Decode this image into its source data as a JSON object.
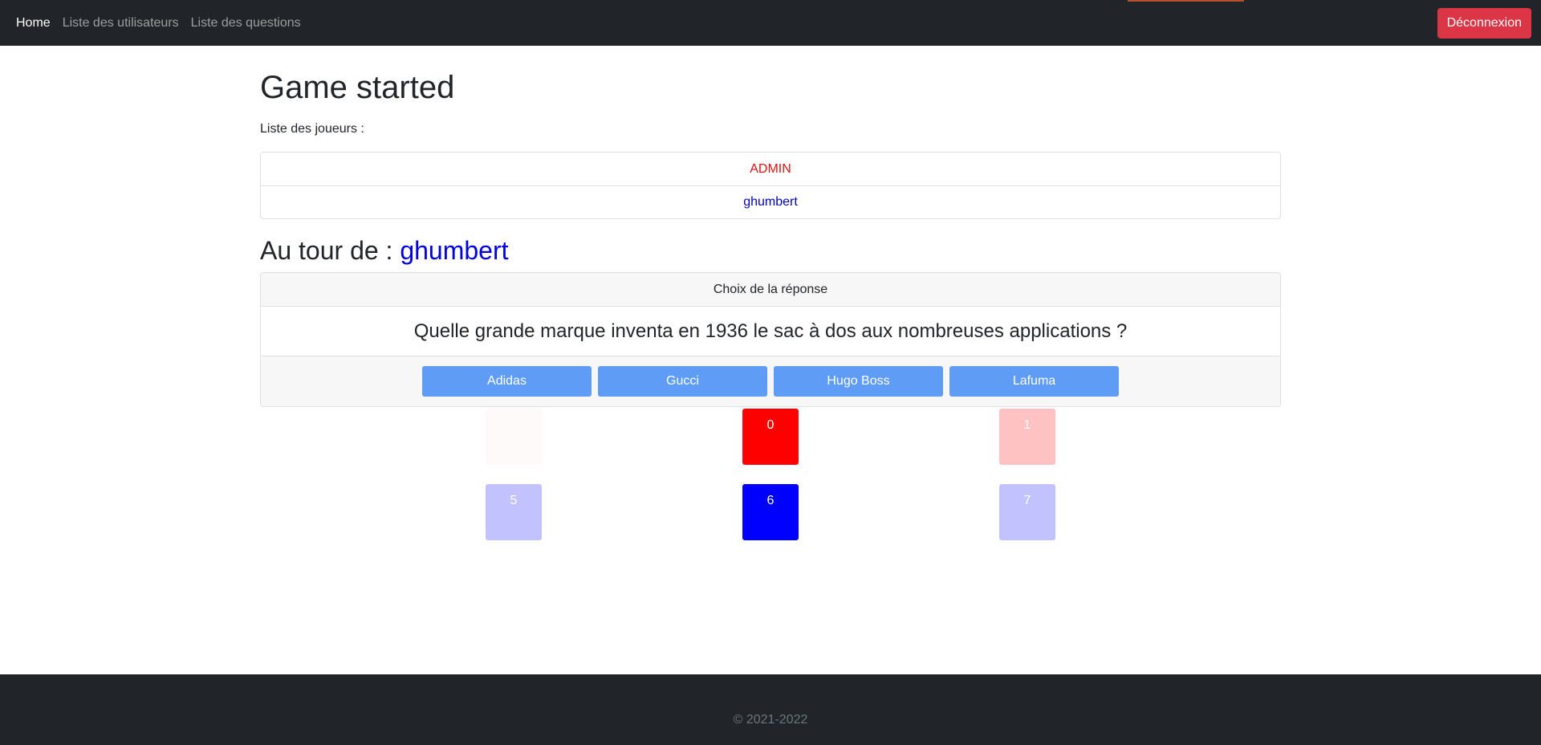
{
  "navbar": {
    "links": [
      {
        "label": "Home",
        "active": true
      },
      {
        "label": "Liste des utilisateurs",
        "active": false
      },
      {
        "label": "Liste des questions",
        "active": false
      }
    ],
    "logout_label": "Déconnexion"
  },
  "page": {
    "title": "Game started",
    "players_label": "Liste des joueurs :",
    "players": [
      {
        "name": "ADMIN",
        "color": "#dd1111"
      },
      {
        "name": "ghumbert",
        "color": "#0000bb"
      }
    ],
    "turn_prefix": "Au tour de : ",
    "turn_player": "ghumbert"
  },
  "question_card": {
    "header": "Choix de la réponse",
    "question": "Quelle grande marque inventa en 1936 le sac à dos aux nombreuses applications ?",
    "answers": [
      "Adidas",
      "Gucci",
      "Hugo Boss",
      "Lafuma"
    ]
  },
  "board": {
    "tiles": [
      {
        "label": "",
        "color": "#fffafa"
      },
      {
        "label": "0",
        "color": "#ff0000"
      },
      {
        "label": "1",
        "color": "#ffc2c2"
      },
      {
        "label": "5",
        "color": "#c2c2ff"
      },
      {
        "label": "6",
        "color": "#0000ff"
      },
      {
        "label": "7",
        "color": "#c2c2ff"
      }
    ]
  },
  "footer": {
    "copyright": "© 2021-2022"
  }
}
